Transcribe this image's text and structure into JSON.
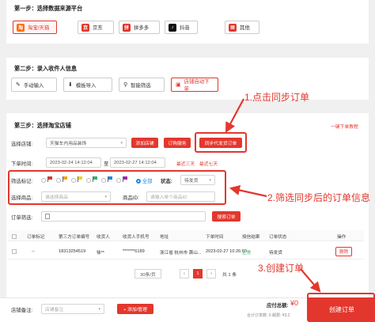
{
  "step1": {
    "title": "第一步：选择数据来源平台",
    "sources": [
      {
        "label": "淘宝/天猫",
        "icon": "taobao-icon",
        "color": "#ff6a00",
        "glyph": "淘"
      },
      {
        "label": "京东",
        "icon": "jd-icon",
        "color": "#e3372d",
        "glyph": "京"
      },
      {
        "label": "拼多多",
        "icon": "pinduoduo-icon",
        "color": "#e02e24",
        "glyph": "拼"
      },
      {
        "label": "抖音",
        "icon": "douyin-icon",
        "color": "#111111",
        "glyph": "♪"
      },
      {
        "label": "其他",
        "icon": "other-icon",
        "color": "#e3372d",
        "glyph": "▦"
      }
    ]
  },
  "step2": {
    "title": "第二步：录入收件人信息",
    "modes": [
      {
        "label": "手动输入",
        "glyph": "✎"
      },
      {
        "label": "模板导入",
        "glyph": "⬇"
      },
      {
        "label": "智能筛选",
        "glyph": "⚲"
      },
      {
        "label": "店铺自动下单",
        "glyph": "▣"
      }
    ]
  },
  "step3": {
    "title": "第三步：选择淘宝店铺",
    "tutorial_link": "一键下单教程",
    "store_label": "选择店铺:",
    "store_value": "天猫车内用品装饰",
    "add_store": "添加店铺",
    "order_service": "订购服务",
    "sync_orders": "同步代发货订单",
    "order_time_label": "下单时间:",
    "time_start": "2023-02-24 14:12:04",
    "time_sep": "至",
    "time_end": "2023-02-27 14:12:04",
    "recent3": "最近三天",
    "recent7": "最近七天"
  },
  "filter": {
    "flag_label": "筛选标记:",
    "flag_colors": [
      "#e3372d",
      "#f7a21b",
      "#f4d31b",
      "#32b16c",
      "#1e88e5",
      "#9c27b0"
    ],
    "all_label": "全部",
    "status_label": "状态:",
    "status_value": "待发货",
    "product_label": "选择商品:",
    "product_placeholder": "请选择商品",
    "product_id_label": "商品ID:",
    "product_id_placeholder": "请输入单个商品ID",
    "order_filter_label": "订单筛选:",
    "search_button": "搜索订单"
  },
  "table": {
    "headers": [
      "订单标记",
      "第三方订单编号",
      "收货人",
      "收货人手机号",
      "地址",
      "下单时间",
      "授信结果",
      "订单状态",
      "操作"
    ],
    "rows": [
      {
        "mark": "--",
        "order_no": "18313254519",
        "name": "徐**",
        "phone": "*******6189",
        "address": "浙江省 杭州市 萧山...",
        "time": "2023-02-27 10:26:03",
        "credit": "正常",
        "status": "待发货",
        "action": "删除"
      }
    ]
  },
  "pagination": {
    "per_page": "30条/页",
    "prev": "‹",
    "current": "1",
    "next": "›",
    "total": "共 1 条"
  },
  "footer": {
    "remark_label": "店铺备注:",
    "remark_placeholder": "店铺备注",
    "add_manage": "+ 添加/管理",
    "payable_label": "应付总额:",
    "payable_value": "¥0",
    "count_text": "合计订单数: 0  邮费: ¥3.2",
    "create_order": "创建订单"
  },
  "annotations": {
    "a1": "1.点击同步订单",
    "a2": "2.筛选同步后的订单信息",
    "a3": "3.创建订单"
  }
}
